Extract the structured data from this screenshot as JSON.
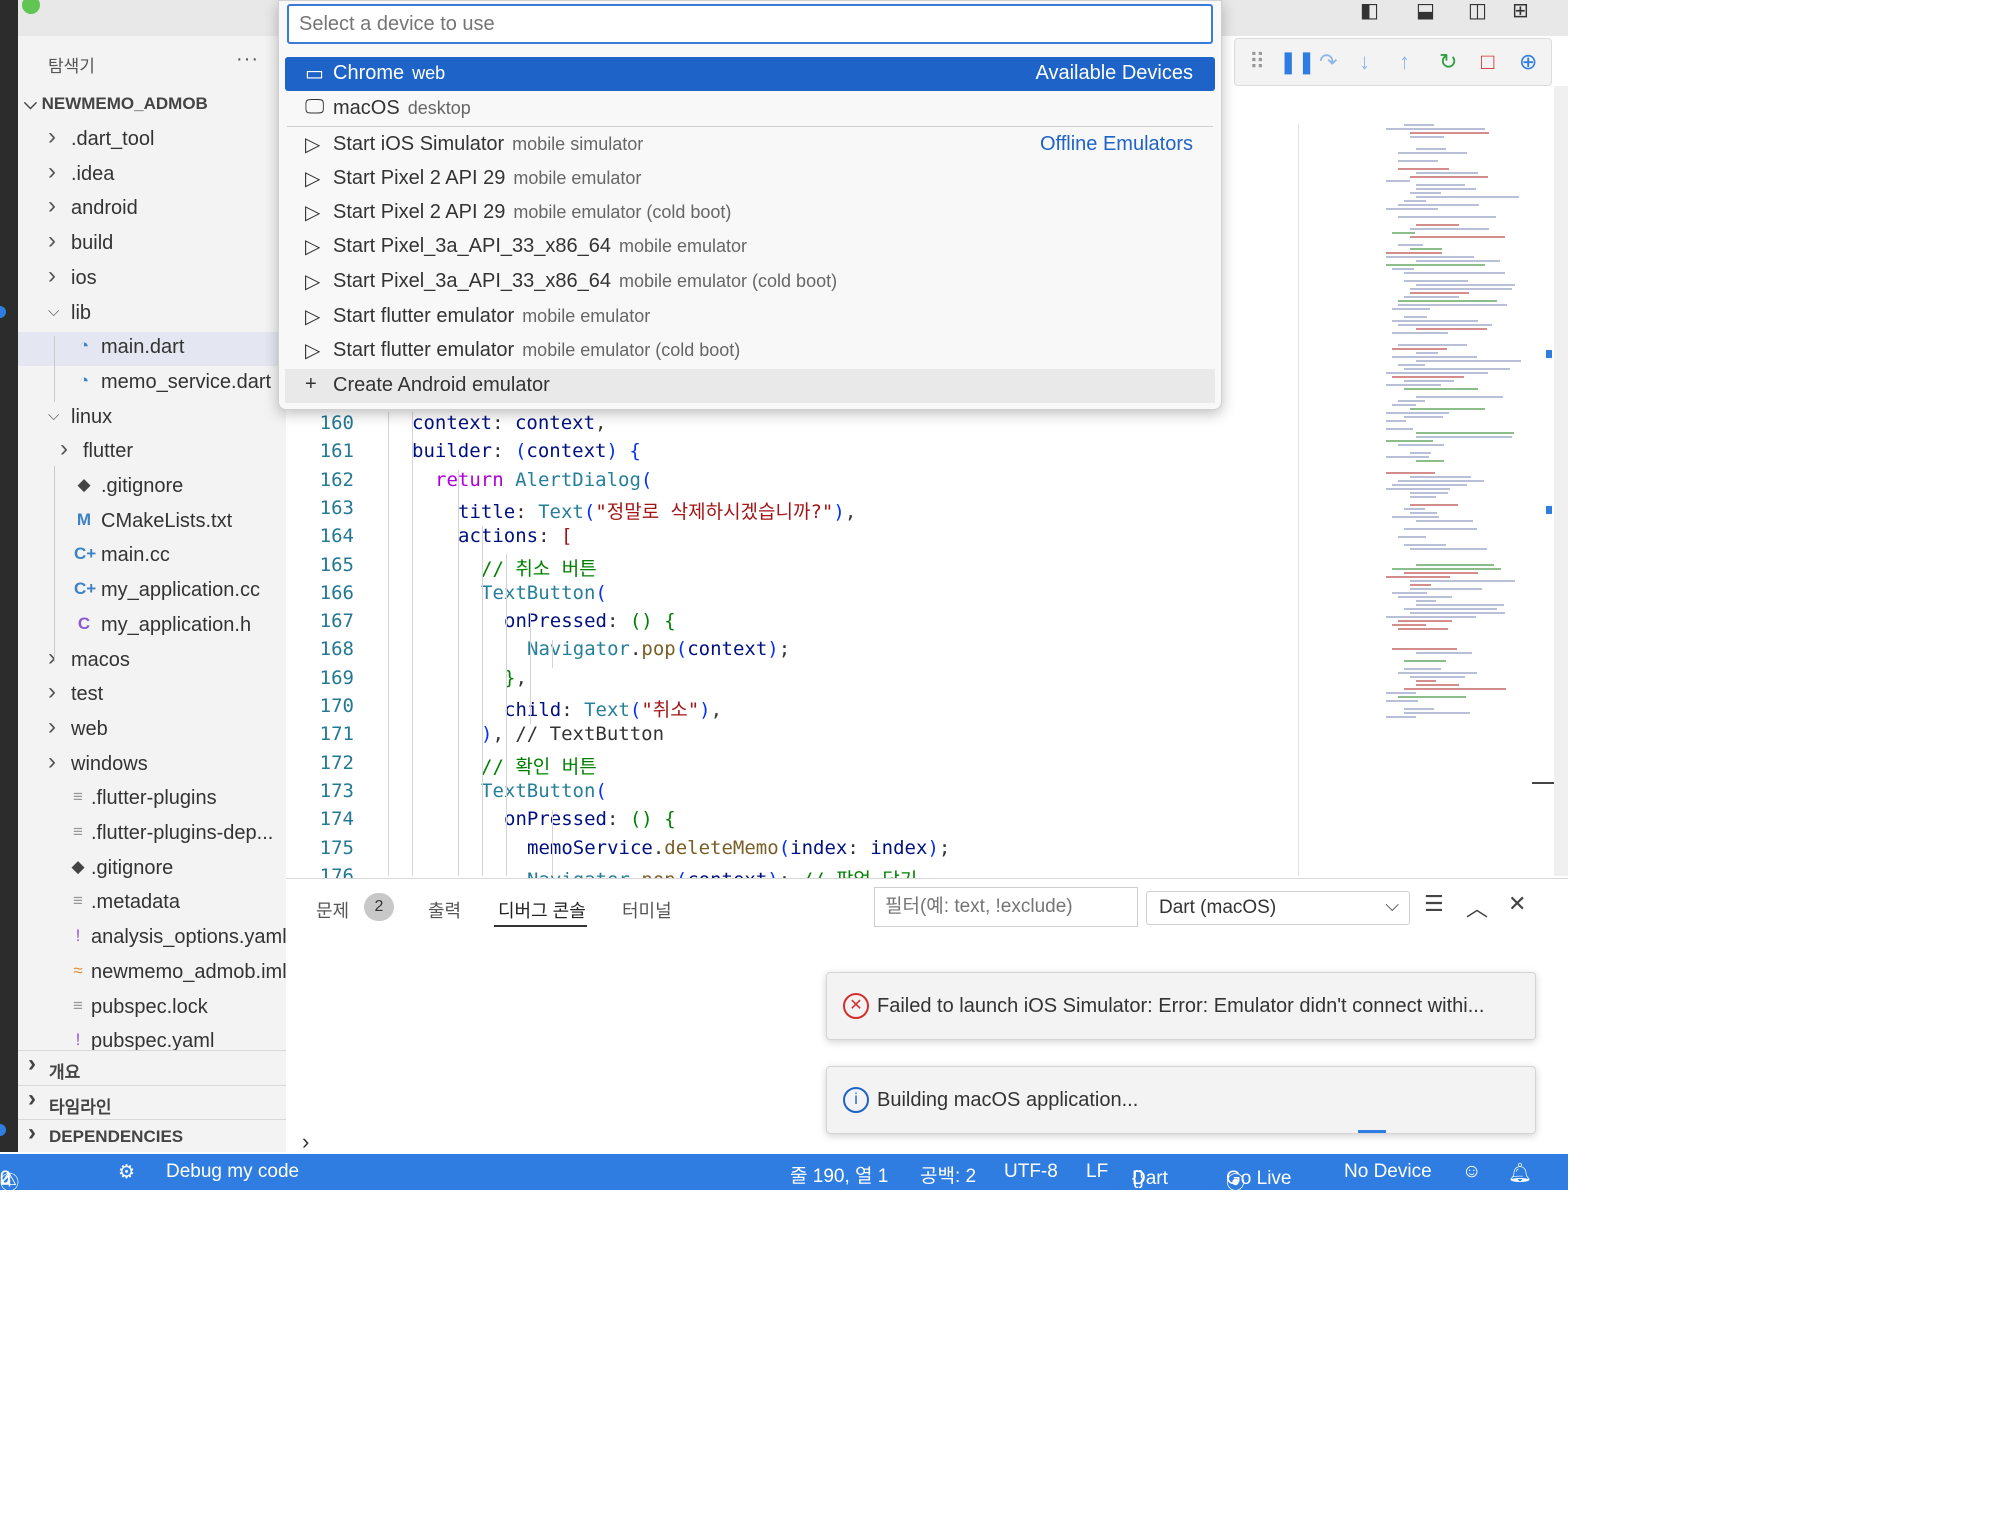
{
  "quick_pick": {
    "placeholder": "Select a device to use",
    "items": [
      {
        "icon": "browser-window-icon",
        "label": "Chrome",
        "detail": "web",
        "right": "Available Devices",
        "active": true
      },
      {
        "icon": "desktop-icon",
        "label": "macOS",
        "detail": "desktop",
        "right": ""
      },
      {
        "icon": "play-icon",
        "label": "Start iOS Simulator",
        "detail": "mobile simulator",
        "right": "Offline Emulators"
      },
      {
        "icon": "play-icon",
        "label": "Start Pixel 2 API 29",
        "detail": "mobile emulator",
        "right": ""
      },
      {
        "icon": "play-icon",
        "label": "Start Pixel 2 API 29",
        "detail": "mobile emulator (cold boot)",
        "right": ""
      },
      {
        "icon": "play-icon",
        "label": "Start Pixel_3a_API_33_x86_64",
        "detail": "mobile emulator",
        "right": ""
      },
      {
        "icon": "play-icon",
        "label": "Start Pixel_3a_API_33_x86_64",
        "detail": "mobile emulator (cold boot)",
        "right": ""
      },
      {
        "icon": "play-icon",
        "label": "Start flutter emulator",
        "detail": "mobile emulator",
        "right": ""
      },
      {
        "icon": "play-icon",
        "label": "Start flutter emulator",
        "detail": "mobile emulator (cold boot)",
        "right": ""
      },
      {
        "icon": "plus-icon",
        "label": "Create Android emulator",
        "detail": "",
        "right": ""
      }
    ]
  },
  "explorer": {
    "title": "탐색기",
    "more": "···",
    "root": "NEWMEMO_ADMOB",
    "items": [
      {
        "label": ".dart_tool",
        "kind": "folder",
        "depth": 0,
        "open": false
      },
      {
        "label": ".idea",
        "kind": "folder",
        "depth": 0,
        "open": false
      },
      {
        "label": "android",
        "kind": "folder",
        "depth": 0,
        "open": false
      },
      {
        "label": "build",
        "kind": "folder",
        "depth": 0,
        "open": false
      },
      {
        "label": "ios",
        "kind": "folder",
        "depth": 0,
        "open": false
      },
      {
        "label": "lib",
        "kind": "folder",
        "depth": 0,
        "open": true
      },
      {
        "label": "main.dart",
        "kind": "dart",
        "depth": 1,
        "selected": true
      },
      {
        "label": "memo_service.dart",
        "kind": "dart",
        "depth": 1
      },
      {
        "label": "linux",
        "kind": "folder",
        "depth": 0,
        "open": true
      },
      {
        "label": "flutter",
        "kind": "folder",
        "depth": 1,
        "open": false
      },
      {
        "label": ".gitignore",
        "kind": "git",
        "depth": 1
      },
      {
        "label": "CMakeLists.txt",
        "kind": "cmake",
        "depth": 1
      },
      {
        "label": "main.cc",
        "kind": "cpp",
        "depth": 1
      },
      {
        "label": "my_application.cc",
        "kind": "cpp",
        "depth": 1
      },
      {
        "label": "my_application.h",
        "kind": "c",
        "depth": 1
      },
      {
        "label": "macos",
        "kind": "folder",
        "depth": 0,
        "open": false
      },
      {
        "label": "test",
        "kind": "folder",
        "depth": 0,
        "open": false
      },
      {
        "label": "web",
        "kind": "folder",
        "depth": 0,
        "open": false
      },
      {
        "label": "windows",
        "kind": "folder",
        "depth": 0,
        "open": false
      },
      {
        "label": ".flutter-plugins",
        "kind": "text",
        "depth": 0
      },
      {
        "label": ".flutter-plugins-dep...",
        "kind": "text",
        "depth": 0
      },
      {
        "label": ".gitignore",
        "kind": "git",
        "depth": 0
      },
      {
        "label": ".metadata",
        "kind": "text",
        "depth": 0
      },
      {
        "label": "analysis_options.yaml",
        "kind": "yaml",
        "depth": 0
      },
      {
        "label": "newmemo_admob.iml",
        "kind": "rss",
        "depth": 0
      },
      {
        "label": "pubspec.lock",
        "kind": "text",
        "depth": 0
      },
      {
        "label": "pubspec.yaml",
        "kind": "yaml",
        "depth": 0
      }
    ],
    "sections": [
      "개요",
      "타임라인",
      "DEPENDENCIES"
    ]
  },
  "editor": {
    "lines": [
      {
        "n": "160",
        "indent": 2,
        "tokens": [
          [
            "id",
            "context"
          ],
          [
            "pl",
            ": "
          ],
          [
            "id",
            "context"
          ],
          [
            "pl",
            ","
          ]
        ]
      },
      {
        "n": "161",
        "indent": 2,
        "tokens": [
          [
            "id",
            "builder"
          ],
          [
            "pl",
            ": "
          ],
          [
            "br",
            "("
          ],
          [
            "id",
            "context"
          ],
          [
            "br",
            ")"
          ],
          [
            "pl",
            " "
          ],
          [
            "br",
            "{"
          ]
        ]
      },
      {
        "n": "162",
        "indent": 3,
        "tokens": [
          [
            "kw",
            "return "
          ],
          [
            "ty",
            "AlertDialog"
          ],
          [
            "br",
            "("
          ]
        ]
      },
      {
        "n": "163",
        "indent": 4,
        "tokens": [
          [
            "id",
            "title"
          ],
          [
            "pl",
            ": "
          ],
          [
            "ty",
            "Text"
          ],
          [
            "br",
            "("
          ],
          [
            "str",
            "\"정말로 삭제하시겠습니까?\""
          ],
          [
            "br",
            ")"
          ],
          [
            "pl",
            ","
          ]
        ]
      },
      {
        "n": "164",
        "indent": 4,
        "tokens": [
          [
            "id",
            "actions"
          ],
          [
            "pl",
            ": "
          ],
          [
            "str",
            "["
          ]
        ]
      },
      {
        "n": "165",
        "indent": 5,
        "tokens": [
          [
            "cm",
            "// 취소 버튼"
          ]
        ]
      },
      {
        "n": "166",
        "indent": 5,
        "tokens": [
          [
            "ty",
            "TextButton"
          ],
          [
            "br",
            "("
          ]
        ]
      },
      {
        "n": "167",
        "indent": 6,
        "tokens": [
          [
            "id",
            "onPressed"
          ],
          [
            "pl",
            ": "
          ],
          [
            "cm",
            "()"
          ],
          [
            "pl",
            " "
          ],
          [
            "cm",
            "{"
          ]
        ]
      },
      {
        "n": "168",
        "indent": 7,
        "tokens": [
          [
            "ty",
            "Navigator"
          ],
          [
            "pl",
            "."
          ],
          [
            "fn",
            "pop"
          ],
          [
            "br",
            "("
          ],
          [
            "id",
            "context"
          ],
          [
            "br",
            ")"
          ],
          [
            "pl",
            ";"
          ]
        ]
      },
      {
        "n": "169",
        "indent": 6,
        "tokens": [
          [
            "cm",
            "}"
          ],
          [
            "pl",
            ","
          ]
        ]
      },
      {
        "n": "170",
        "indent": 6,
        "tokens": [
          [
            "id",
            "child"
          ],
          [
            "pl",
            ": "
          ],
          [
            "ty",
            "Text"
          ],
          [
            "br",
            "("
          ],
          [
            "str",
            "\"취소\""
          ],
          [
            "br",
            ")"
          ],
          [
            "pl",
            ","
          ]
        ]
      },
      {
        "n": "171",
        "indent": 5,
        "tokens": [
          [
            "br",
            ")"
          ],
          [
            "pl",
            ", "
          ],
          [
            "pl",
            "// TextButton"
          ]
        ]
      },
      {
        "n": "172",
        "indent": 5,
        "tokens": [
          [
            "cm",
            "// 확인 버튼"
          ]
        ]
      },
      {
        "n": "173",
        "indent": 5,
        "tokens": [
          [
            "ty",
            "TextButton"
          ],
          [
            "br",
            "("
          ]
        ]
      },
      {
        "n": "174",
        "indent": 6,
        "tokens": [
          [
            "id",
            "onPressed"
          ],
          [
            "pl",
            ": "
          ],
          [
            "cm",
            "()"
          ],
          [
            "pl",
            " "
          ],
          [
            "cm",
            "{"
          ]
        ]
      },
      {
        "n": "175",
        "indent": 7,
        "tokens": [
          [
            "id",
            "memoService"
          ],
          [
            "pl",
            "."
          ],
          [
            "fn",
            "deleteMemo"
          ],
          [
            "br",
            "("
          ],
          [
            "id",
            "index"
          ],
          [
            "pl",
            ": "
          ],
          [
            "id",
            "index"
          ],
          [
            "br",
            ")"
          ],
          [
            "pl",
            ";"
          ]
        ]
      },
      {
        "n": "176",
        "indent": 7,
        "tokens": [
          [
            "ty",
            "Navigator"
          ],
          [
            "pl",
            "."
          ],
          [
            "fn",
            "pop"
          ],
          [
            "br",
            "("
          ],
          [
            "id",
            "context"
          ],
          [
            "br",
            ")"
          ],
          [
            "pl",
            "; "
          ],
          [
            "cm",
            "// 팝업 닫기"
          ]
        ]
      }
    ]
  },
  "panel": {
    "tabs": [
      "문제",
      "출력",
      "디버그 콘솔",
      "터미널"
    ],
    "problems_count": "2",
    "active_tab": "디버그 콘솔",
    "filter_placeholder": "필터(예: text, !exclude)",
    "select_value": "Dart (macOS)",
    "prompt": "›"
  },
  "notifications": [
    {
      "type": "error",
      "text": "Failed to launch iOS Simulator: Error: Emulator didn't connect withi..."
    },
    {
      "type": "info",
      "text": "Building macOS application..."
    }
  ],
  "statusbar": {
    "warnings": "0",
    "infos": "2",
    "debug": "Debug my code",
    "position": "줄 190, 열 1",
    "spaces": "공백: 2",
    "encoding": "UTF-8",
    "eol": "LF",
    "language": "Dart",
    "golive": "Go Live",
    "device": "No Device"
  },
  "colors": {
    "accent": "#2f7de1",
    "quickpick_active": "#1e64c8",
    "error": "#d32f2f",
    "info": "#1e64c8"
  }
}
